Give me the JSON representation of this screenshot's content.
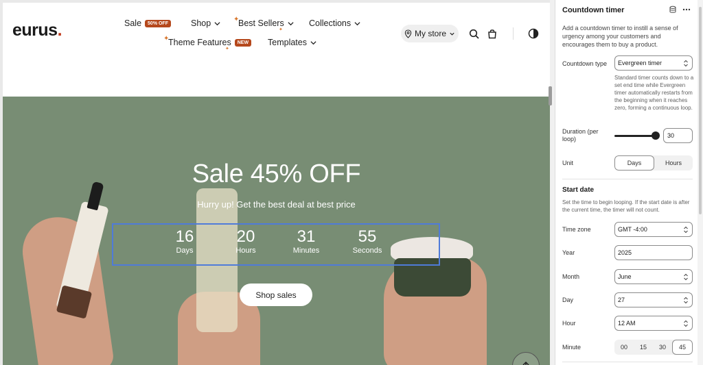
{
  "store": {
    "logo": "eurus",
    "logo_dot": ".",
    "nav": {
      "sale": "Sale",
      "sale_badge": "50% OFF",
      "shop": "Shop",
      "best_sellers": "Best Sellers",
      "collections": "Collections",
      "theme_features": "Theme Features",
      "new_badge": "NEW",
      "templates": "Templates"
    },
    "my_store": "My store",
    "colors": {
      "sale_badge": "#b5481c",
      "hero_bg": "#788d74",
      "timer_outline": "#4f7bd9",
      "spark": "#d8752a"
    },
    "icons": [
      "location-pin-icon",
      "search-icon",
      "cart-icon",
      "theme-toggle-icon",
      "arrow-up-icon"
    ]
  },
  "hero": {
    "title": "Sale 45% OFF",
    "subtitle": "Hurry up! Get the best deal at best price",
    "timer": [
      {
        "value": "16",
        "label": "Days"
      },
      {
        "value": "20",
        "label": "Hours"
      },
      {
        "value": "31",
        "label": "Minutes"
      },
      {
        "value": "55",
        "label": "Seconds"
      }
    ],
    "button": "Shop sales"
  },
  "panel": {
    "title": "Countdown timer",
    "description": "Add a countdown timer to instill a sense of urgency among your customers and encourages them to buy a product.",
    "countdown_type_label": "Countdown type",
    "countdown_type_value": "Evergreen timer",
    "countdown_type_help": "Standard timer counts down to a set end time while Evergreen timer automatically restarts from the beginning when it reaches zero, forming a continuous loop.",
    "duration_label": "Duration (per loop)",
    "duration_value": "30",
    "duration_fraction": 0.92,
    "unit_label": "Unit",
    "unit_options": [
      "Days",
      "Hours"
    ],
    "unit_selected": "Days",
    "start_date_title": "Start date",
    "start_date_desc": "Set the time to begin looping. If the start date is after the current time, the timer will not count.",
    "time_zone_label": "Time zone",
    "time_zone_value": "GMT -4:00",
    "year_label": "Year",
    "year_value": "2025",
    "month_label": "Month",
    "month_value": "June",
    "day_label": "Day",
    "day_value": "27",
    "hour_label": "Hour",
    "hour_value": "12 AM",
    "minute_label": "Minute",
    "minute_options": [
      "00",
      "15",
      "30",
      "45"
    ],
    "minute_selected": "45",
    "icons": [
      "database-icon",
      "more-icon"
    ]
  }
}
